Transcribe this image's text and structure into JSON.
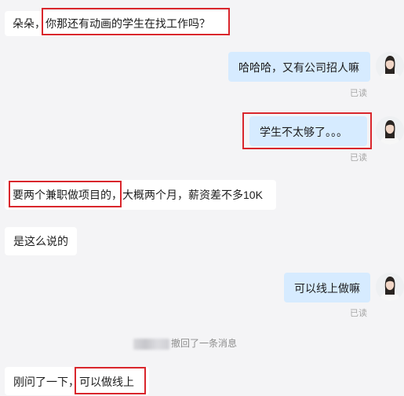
{
  "messages": [
    {
      "side": "left",
      "parts": [
        "朵朵，",
        "你那还有动画的学生在找工作吗？"
      ]
    },
    {
      "side": "right",
      "text": "哈哈哈，又有公司招人嘛",
      "status": "已读"
    },
    {
      "side": "right",
      "text": "学生不太够了。。。",
      "status": "已读"
    },
    {
      "side": "left",
      "parts": [
        "要两个兼职做项目的，",
        "大概两个月，薪资差不多10K"
      ]
    },
    {
      "side": "left",
      "text": "是这么说的"
    },
    {
      "side": "right",
      "text": "可以线上做嘛",
      "status": "已读"
    },
    {
      "side": "system",
      "text": "撤回了一条消息"
    },
    {
      "side": "left",
      "parts": [
        "刚问了一下，",
        "可以做线上"
      ]
    }
  ],
  "colors": {
    "background": "#f4f4f6",
    "bubble_left": "#ffffff",
    "bubble_right": "#d6ebff",
    "highlight_border": "#d9262c"
  },
  "icons": {
    "avatar": "user-avatar-icon"
  }
}
